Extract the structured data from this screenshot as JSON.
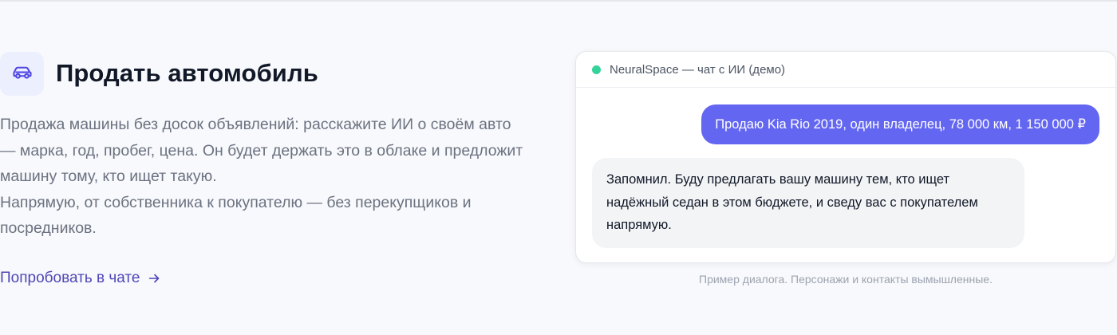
{
  "feature": {
    "icon": "car-icon",
    "title": "Продать автомобиль",
    "description_lines": [
      "Продажа машины без досок объявлений: расскажите ИИ о своём авто",
      "— марка, год, пробег, цена. Он будет держать это в облаке и предложит",
      "машину тому, кто ищет такую.",
      "Напрямую, от собственника к покупателю — без перекупщиков и",
      "посредников."
    ],
    "cta_label": "Попробовать в чате",
    "cta_icon": "arrow-right-icon"
  },
  "chat": {
    "title": "NeuralSpace — чат с ИИ (демо)",
    "status_color": "#34d399",
    "user_message": "Продаю Kia Rio 2019, один владелец, 78 000 км, 1 150 000 ₽",
    "ai_message_lines": [
      "Запомнил. Буду предлагать вашу машину тем, кто ищет",
      "надёжный седан в этом бюджете, и сведу вас с покупателем",
      "напрямую."
    ],
    "caption": "Пример диалога. Персонажи и контакты вымышленные."
  },
  "colors": {
    "accent": "#6366f1",
    "link": "#5046b8",
    "title": "#111827",
    "muted": "#6b7280"
  }
}
